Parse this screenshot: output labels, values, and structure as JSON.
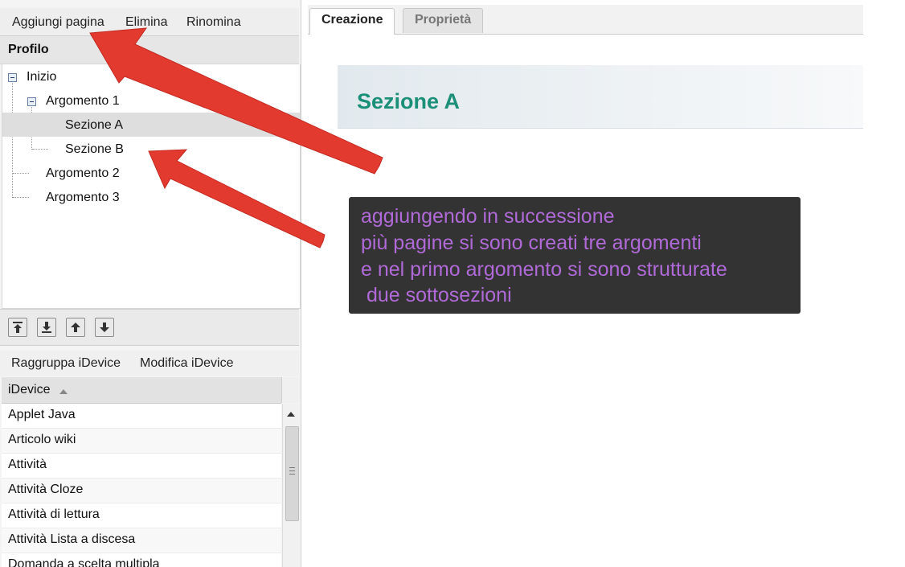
{
  "outline_menu": {
    "add_page": "Aggiungi pagina",
    "delete": "Elimina",
    "rename": "Rinomina"
  },
  "outline": {
    "header": "Profilo",
    "nodes": [
      {
        "label": "Inizio",
        "expanded": true
      },
      {
        "label": "Argomento 1",
        "expanded": true
      },
      {
        "label": "Sezione A",
        "selected": true
      },
      {
        "label": "Sezione B"
      },
      {
        "label": "Argomento 2"
      },
      {
        "label": "Argomento 3"
      }
    ]
  },
  "outline_toolbar": [
    "move-top-icon",
    "move-bottom-icon",
    "move-up-icon",
    "move-down-icon"
  ],
  "idevice_menu": {
    "group": "Raggruppa iDevice",
    "edit": "Modifica iDevice"
  },
  "idevice_list": {
    "header": "iDevice",
    "sort": "ascending",
    "items": [
      "Applet Java",
      "Articolo wiki",
      "Attività",
      "Attività Cloze",
      "Attività di lettura",
      "Attività Lista a discesa",
      "Domanda a scelta multipla"
    ]
  },
  "tabs": {
    "active": "Creazione",
    "other": "Proprietà"
  },
  "page_title": "Sezione A",
  "annotation": {
    "lines": [
      "aggiungendo in successione",
      "più pagine si sono creati tre argomenti",
      "e nel primo argomento si sono strutturate",
      " due sottosezioni"
    ]
  },
  "colors": {
    "section_title": "#1b8f77",
    "note_bg": "#333333",
    "note_text": "#b06ad8",
    "arrow": "#e33a2f"
  }
}
